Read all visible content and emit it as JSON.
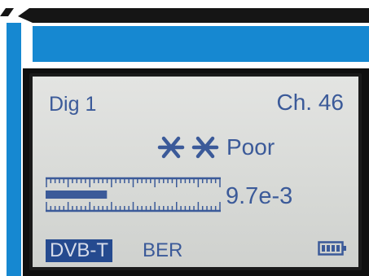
{
  "display": {
    "mode": "Dig 1",
    "channel": "Ch. 46",
    "quality_label": "Poor",
    "quality_icon": "snowflake-icon",
    "ber_value": "9.7e-3",
    "ber_bar_level": 0.35,
    "standard_badge": "DVB-T",
    "measure_label": "BER",
    "battery_icon": "battery-icon",
    "text_color": "#3b5a99",
    "lcd_color": "#d9dbd8"
  }
}
